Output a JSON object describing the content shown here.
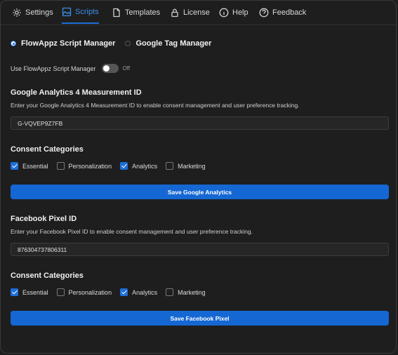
{
  "tabs": [
    {
      "label": "Settings",
      "icon": "gear-icon"
    },
    {
      "label": "Scripts",
      "icon": "image-icon",
      "active": true
    },
    {
      "label": "Templates",
      "icon": "document-icon"
    },
    {
      "label": "License",
      "icon": "lock-icon"
    },
    {
      "label": "Help",
      "icon": "info-icon"
    },
    {
      "label": "Feedback",
      "icon": "question-icon"
    }
  ],
  "manager": {
    "options": [
      "FlowAppz Script Manager",
      "Google Tag Manager"
    ],
    "selected": "FlowAppz Script Manager"
  },
  "toggle": {
    "label": "Use FlowAppz Script Manager",
    "state": "Off",
    "on": false
  },
  "ga": {
    "heading": "Google Analytics 4 Measurement ID",
    "description": "Enter your Google Analytics 4 Measurement ID to enable consent management and user preference tracking.",
    "value": "G-VQVEP9Z7FB",
    "categories_heading": "Consent Categories",
    "categories": [
      {
        "label": "Essential",
        "checked": true
      },
      {
        "label": "Personalization",
        "checked": false
      },
      {
        "label": "Analytics",
        "checked": true
      },
      {
        "label": "Marketing",
        "checked": false
      }
    ],
    "save_label": "Save Google Analytics"
  },
  "fb": {
    "heading": "Facebook Pixel ID",
    "description": "Enter your Facebook Pixel ID to enable consent management and user preference tracking.",
    "value": "876304737806311",
    "categories_heading": "Consent Categories",
    "categories": [
      {
        "label": "Essential",
        "checked": true
      },
      {
        "label": "Personalization",
        "checked": false
      },
      {
        "label": "Analytics",
        "checked": true
      },
      {
        "label": "Marketing",
        "checked": false
      }
    ],
    "save_label": "Save Facebook Pixel"
  },
  "colors": {
    "accent": "#1567d3",
    "background": "#1e1e1e"
  }
}
